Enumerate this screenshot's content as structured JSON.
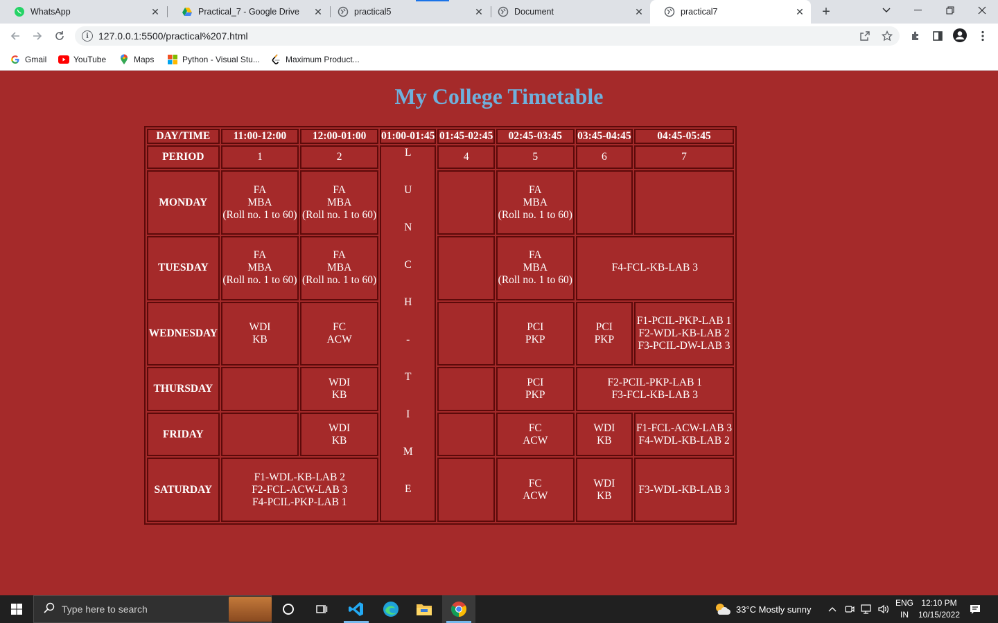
{
  "browser": {
    "tabs": [
      {
        "title": "WhatsApp",
        "icon": "whatsapp-icon",
        "active": false
      },
      {
        "title": "Practical_7 - Google Drive",
        "icon": "google-drive-icon",
        "active": false
      },
      {
        "title": "practical5",
        "icon": "globe-icon",
        "active": false
      },
      {
        "title": "Document",
        "icon": "globe-icon",
        "active": false
      },
      {
        "title": "practical7",
        "icon": "globe-icon",
        "active": true
      }
    ],
    "url": "127.0.0.1:5500/practical%207.html",
    "bookmarks": [
      {
        "label": "Gmail",
        "icon": "google-icon"
      },
      {
        "label": "YouTube",
        "icon": "youtube-icon"
      },
      {
        "label": "Maps",
        "icon": "maps-pin-icon"
      },
      {
        "label": "Python - Visual Stu...",
        "icon": "windows-grid-icon"
      },
      {
        "label": "Maximum Product...",
        "icon": "leetcode-icon"
      }
    ]
  },
  "page": {
    "title": "My College Timetable",
    "title_color": "#6fb0dc",
    "background": "#a52a2a",
    "table": {
      "header": [
        "DAY/TIME",
        "11:00-12:00",
        "12:00-01:00",
        "01:00-01:45",
        "01:45-02:45",
        "02:45-03:45",
        "03:45-04:45",
        "04:45-05:45"
      ],
      "period_label": "PERIOD",
      "periods": [
        "1",
        "2",
        "4",
        "5",
        "6",
        "7"
      ],
      "lunch_letters": [
        "L",
        "U",
        "N",
        "C",
        "H",
        "-",
        "T",
        "I",
        "M",
        "E"
      ],
      "days": {
        "monday": {
          "name": "MONDAY",
          "p1": [
            "FA",
            "MBA",
            "(Roll no. 1 to 60)"
          ],
          "p2": [
            "FA",
            "MBA",
            "(Roll no. 1 to 60)"
          ],
          "p5": [
            "FA",
            "MBA",
            "(Roll no. 1 to 60)"
          ]
        },
        "tuesday": {
          "name": "TUESDAY",
          "p1": [
            "FA",
            "MBA",
            "(Roll no. 1 to 60)"
          ],
          "p2": [
            "FA",
            "MBA",
            "(Roll no. 1 to 60)"
          ],
          "p5": [
            "FA",
            "MBA",
            "(Roll no. 1 to 60)"
          ],
          "p67": "F4-FCL-KB-LAB 3"
        },
        "wednesday": {
          "name": "WEDNESDAY",
          "p1": [
            "WDI",
            "KB"
          ],
          "p2": [
            "FC",
            "ACW"
          ],
          "p5": [
            "PCI",
            "PKP"
          ],
          "p6": [
            "PCI",
            "PKP"
          ],
          "p7": [
            "F1-PCIL-PKP-LAB 1",
            "F2-WDL-KB-LAB 2",
            "F3-PCIL-DW-LAB 3"
          ]
        },
        "thursday": {
          "name": "THURSDAY",
          "p2": [
            "WDI",
            "KB"
          ],
          "p5": [
            "PCI",
            "PKP"
          ],
          "p67": [
            "F2-PCIL-PKP-LAB 1",
            "F3-FCL-KB-LAB 3"
          ]
        },
        "friday": {
          "name": "FRIDAY",
          "p2": [
            "WDI",
            "KB"
          ],
          "p5": [
            "FC",
            "ACW"
          ],
          "p6": [
            "WDI",
            "KB"
          ],
          "p7": [
            "F1-FCL-ACW-LAB 3",
            "F4-WDL-KB-LAB 2"
          ]
        },
        "saturday": {
          "name": "SATURDAY",
          "p12": [
            "F1-WDL-KB-LAB 2",
            "F2-FCL-ACW-LAB 3",
            "F4-PCIL-PKP-LAB 1"
          ],
          "p5": [
            "FC",
            "ACW"
          ],
          "p6": [
            "WDI",
            "KB"
          ],
          "p7": "F3-WDL-KB-LAB 3"
        }
      }
    }
  },
  "taskbar": {
    "search_placeholder": "Type here to search",
    "weather": "33°C  Mostly sunny",
    "lang_top": "ENG",
    "lang_bottom": "IN",
    "time": "12:10 PM",
    "date": "10/15/2022"
  }
}
